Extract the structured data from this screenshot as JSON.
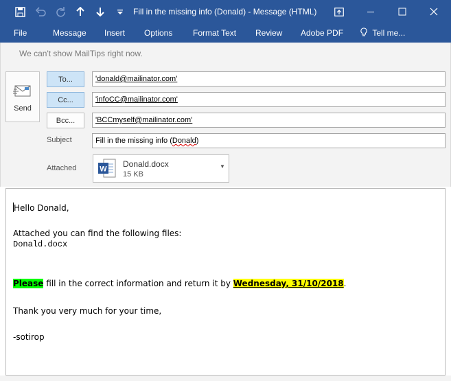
{
  "window": {
    "title": "Fill in the missing info (Donald) - Message (HTML)",
    "accent_color": "#2b579a",
    "quick_access_icons": [
      "save-icon",
      "undo-icon",
      "redo-icon",
      "arrow-up-icon",
      "arrow-down-icon",
      "customize-icon"
    ],
    "control_icons": [
      "ribbon-display-icon",
      "minimize-icon",
      "maximize-icon",
      "close-icon"
    ]
  },
  "menu": {
    "items": [
      "File",
      "Message",
      "Insert",
      "Options",
      "Format Text",
      "Review",
      "Adobe PDF",
      "Tell me..."
    ]
  },
  "mailtips": "We can't show MailTips right now.",
  "send": {
    "label": "Send"
  },
  "to": {
    "button": "To...",
    "value": "'donald@mailinator.com'"
  },
  "cc": {
    "button": "Cc...",
    "value": "'infoCC@mailinator.com'"
  },
  "bcc": {
    "button": "Bcc...",
    "value": "'BCCmyself@mailinator.com'"
  },
  "subject": {
    "label": "Subject",
    "value_prefix": "Fill in the missing info (",
    "value_name": "Donald",
    "value_suffix": ")"
  },
  "attached": {
    "label": "Attached",
    "file_name": "Donald.docx",
    "file_size": "15 KB"
  },
  "body": {
    "greeting": "Hello Donald,",
    "attached_intro": "Attached you can find the following files:",
    "file": "Donald.docx",
    "please": "Please",
    "instruction": " fill in the correct information and return it by ",
    "deadline": "Wednesday, 31/10/2018",
    "period": ".",
    "thanks": "Thank you very much for your time,",
    "signature": "-sotirop",
    "highlight_green": "#00ff00",
    "highlight_yellow": "#ffff00"
  }
}
